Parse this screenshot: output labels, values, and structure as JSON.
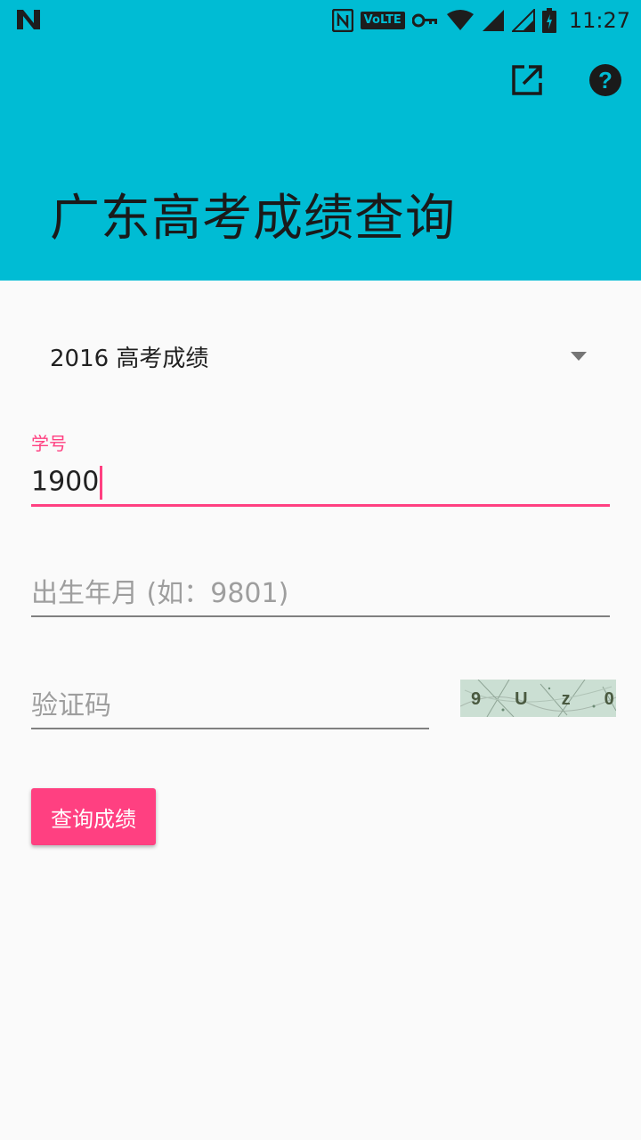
{
  "status_bar": {
    "network_label": "VoLTE",
    "time": "11:27",
    "icons": [
      "n-notification-icon",
      "nfc-icon",
      "volte-icon",
      "vpn-key-icon",
      "wifi-icon",
      "signal-icon",
      "signal-icon",
      "battery-icon"
    ]
  },
  "app_bar": {
    "title": "广东高考成绩查询",
    "background": "#00bcd4",
    "actions": [
      "open-in-new-icon",
      "help-icon"
    ]
  },
  "form": {
    "year_select": {
      "selected": "2016 高考成绩"
    },
    "student_id": {
      "label": "学号",
      "value": "1900"
    },
    "birth_date": {
      "placeholder": "出生年月 (如：9801)"
    },
    "captcha": {
      "placeholder": "验证码",
      "image_text": "9Uz0"
    },
    "submit_label": "查询成绩"
  },
  "colors": {
    "accent": "#ff4081",
    "primary": "#00bcd4"
  }
}
